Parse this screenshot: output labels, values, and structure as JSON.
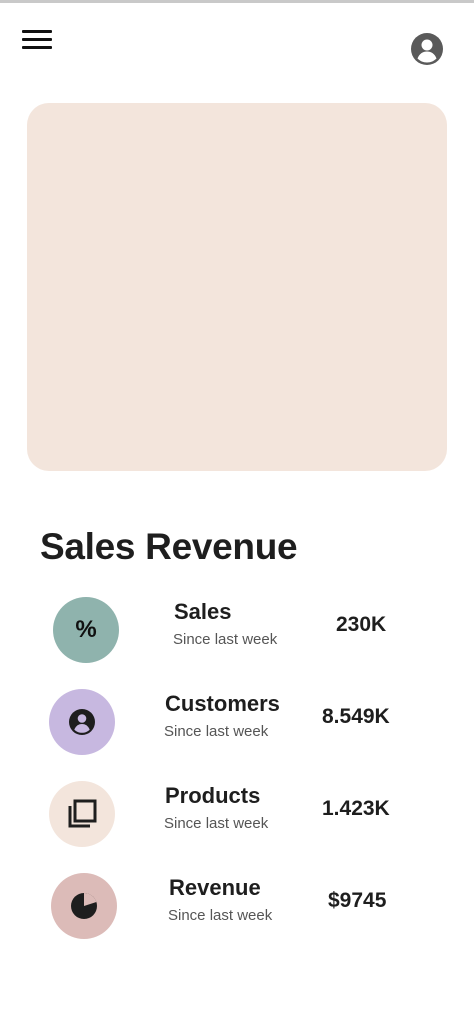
{
  "colors": {
    "hero_card": "#f3e5dc",
    "sales_icon_bg": "#8fb3ad",
    "customers_icon_bg": "#c7b8e0",
    "products_icon_bg": "#f3e5dc",
    "revenue_icon_bg": "#dcbbb8"
  },
  "header": {
    "menu_icon": "hamburger-menu-icon",
    "account_icon": "account-circle-icon"
  },
  "section": {
    "title": "Sales Revenue"
  },
  "metrics": [
    {
      "label": "Sales",
      "subtitle": "Since last week",
      "value": "230K",
      "icon": "percent-icon",
      "icon_glyph": "%"
    },
    {
      "label": "Customers",
      "subtitle": "Since last week",
      "value": "8.549K",
      "icon": "account-circle-icon"
    },
    {
      "label": "Products",
      "subtitle": "Since last week",
      "value": "1.423K",
      "icon": "library-stack-icon"
    },
    {
      "label": "Revenue",
      "subtitle": "Since last week",
      "value": "$9745",
      "icon": "pie-chart-icon"
    }
  ]
}
